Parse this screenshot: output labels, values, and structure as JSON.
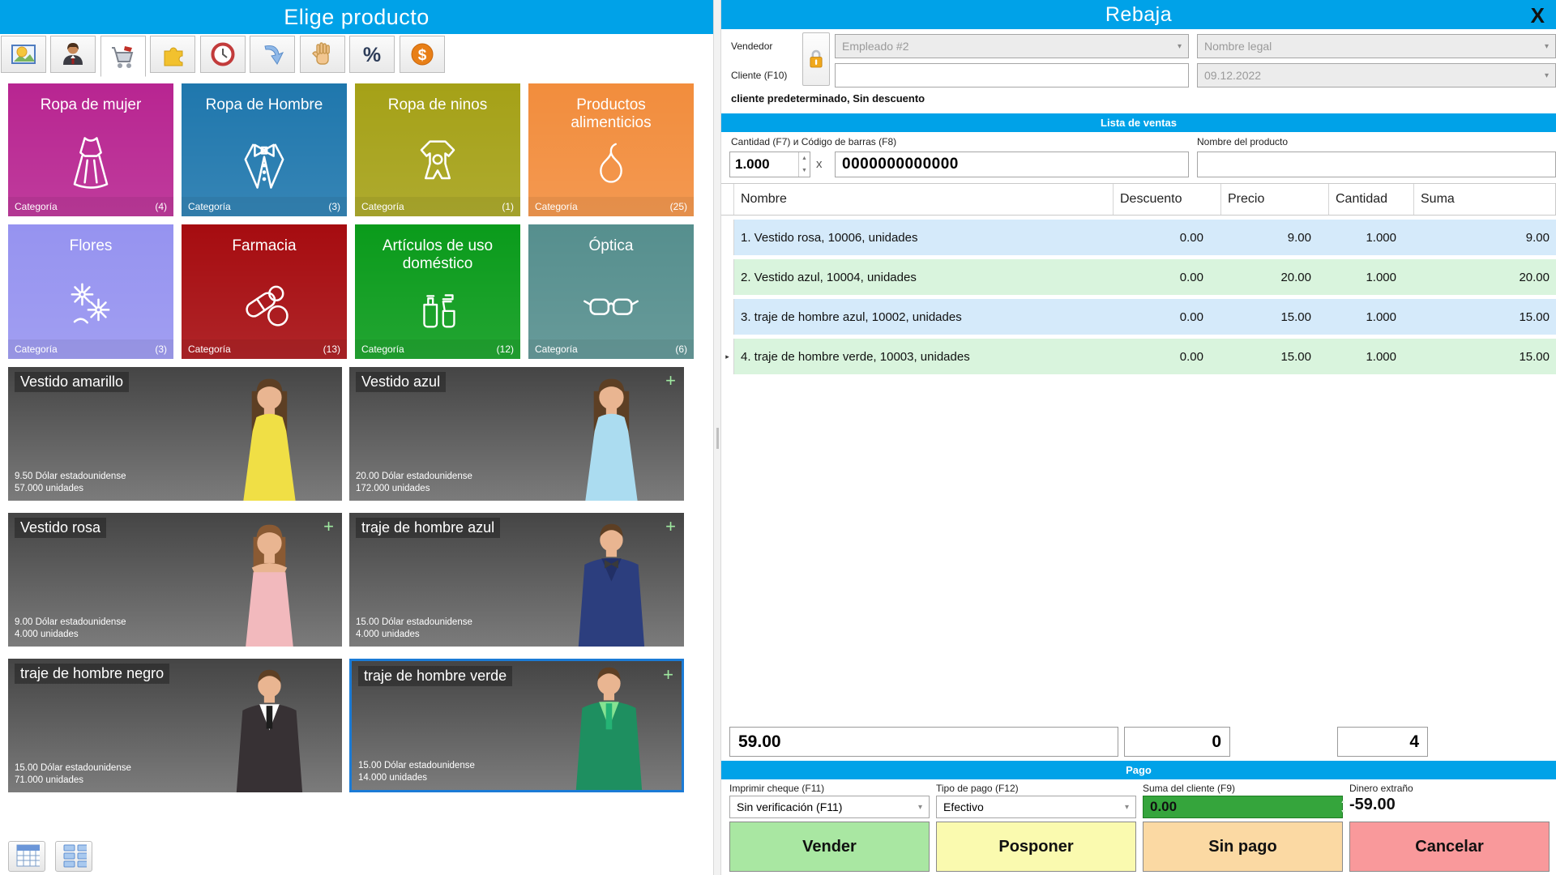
{
  "colors": {
    "titlebar_blue": "#00a2e8",
    "row_blue": "#d5eafa",
    "row_green": "#d9f4dd",
    "suma_input_green": "#35a53c"
  },
  "left_panel": {
    "title": "Elige producto",
    "toolbar": {
      "active_index": 2,
      "icons": [
        "picture-icon",
        "person-icon",
        "cart-icon",
        "puzzle-icon",
        "clock-icon",
        "arrow-icon",
        "hand-icon",
        "percent-icon",
        "dollar-icon"
      ]
    },
    "categories": [
      {
        "label": "Ropa de mujer",
        "footer": "Categoría",
        "count": "(4)",
        "color": "#b82591",
        "icon": "dress-icon"
      },
      {
        "label": "Ropa de Hombre",
        "footer": "Categoría",
        "count": "(3)",
        "color": "#1f77ad",
        "icon": "suit-icon"
      },
      {
        "label": "Ropa de ninos",
        "footer": "Categoría",
        "count": "(1)",
        "color": "#a5a117",
        "icon": "baby-clothes-icon"
      },
      {
        "label": "Productos alimenticios",
        "footer": "Categoría",
        "count": "(25)",
        "color": "#f28d3d",
        "icon": "pear-icon"
      },
      {
        "label": "Flores",
        "footer": "Categoría",
        "count": "(3)",
        "color": "#9693f0",
        "icon": "flowers-icon"
      },
      {
        "label": "Farmacia",
        "footer": "Categoría",
        "count": "(13)",
        "color": "#a60c10",
        "icon": "pills-icon"
      },
      {
        "label": "Artículos de uso doméstico",
        "footer": "Categoría",
        "count": "(12)",
        "color": "#0a9b1b",
        "icon": "cleaning-icon"
      },
      {
        "label": "Óptica",
        "footer": "Categoría",
        "count": "(6)",
        "color": "#568f8e",
        "icon": "glasses-icon"
      }
    ],
    "products": [
      {
        "name": "Vestido amarillo",
        "price": "9.50 Dólar estadounidense",
        "stock": "57.000 unidades",
        "plus": "",
        "selected": false
      },
      {
        "name": "Vestido azul",
        "price": "20.00 Dólar estadounidense",
        "stock": "172.000 unidades",
        "plus": "+",
        "selected": false
      },
      {
        "name": "Vestido rosa",
        "price": "9.00 Dólar estadounidense",
        "stock": "4.000 unidades",
        "plus": "+",
        "selected": false
      },
      {
        "name": "traje de hombre azul",
        "price": "15.00 Dólar estadounidense",
        "stock": "4.000 unidades",
        "plus": "+",
        "selected": false
      },
      {
        "name": "traje de hombre negro",
        "price": "15.00 Dólar estadounidense",
        "stock": "71.000 unidades",
        "plus": "",
        "selected": false
      },
      {
        "name": "traje de hombre verde",
        "price": "15.00 Dólar estadounidense",
        "stock": "14.000 unidades",
        "plus": "+",
        "selected": true
      }
    ],
    "view_buttons": [
      "table-view-icon",
      "tiles-view-icon"
    ]
  },
  "right_panel": {
    "title": "Rebaja",
    "close_label": "X",
    "form": {
      "vendedor_label": "Vendedor",
      "vendedor_value": "Empleado #2",
      "nombre_legal_value": "Nombre legal",
      "cliente_label": "Cliente (F10)",
      "cliente_value": "",
      "date_value": "09.12.2022",
      "status_line": "cliente predeterminado, Sin descuento"
    },
    "sales": {
      "header": "Lista de ventas",
      "qty_barcode_label": "Cantidad (F7) и Código de barras (F8)",
      "qty_value": "1.000",
      "times_label": "x",
      "barcode_value": "0000000000000",
      "product_name_label": "Nombre del producto",
      "product_name_value": "",
      "columns": [
        "Nombre",
        "Descuento",
        "Precio",
        "Cantidad",
        "Suma"
      ],
      "rows": [
        {
          "marker": "",
          "nombre": "1. Vestido rosa, 10006, unidades",
          "descuento": "0.00",
          "precio": "9.00",
          "cantidad": "1.000",
          "suma": "9.00",
          "bg": "#d5eafa"
        },
        {
          "marker": "",
          "nombre": "2. Vestido azul, 10004, unidades",
          "descuento": "0.00",
          "precio": "20.00",
          "cantidad": "1.000",
          "suma": "20.00",
          "bg": "#d9f4dd"
        },
        {
          "marker": "",
          "nombre": "3. traje de hombre azul, 10002, unidades",
          "descuento": "0.00",
          "precio": "15.00",
          "cantidad": "1.000",
          "suma": "15.00",
          "bg": "#d5eafa"
        },
        {
          "marker": "▸",
          "nombre": "4. traje de hombre verde, 10003, unidades",
          "descuento": "0.00",
          "precio": "15.00",
          "cantidad": "1.000",
          "suma": "15.00",
          "bg": "#d9f4dd"
        }
      ],
      "totals": {
        "suma": "59.00",
        "descuento": "0",
        "cantidad": "4"
      }
    },
    "payment": {
      "header": "Pago",
      "imprimir_label": "Imprimir cheque (F11)",
      "imprimir_value": "Sin verificación (F11)",
      "tipo_label": "Tipo de pago (F12)",
      "tipo_value": "Efectivo",
      "suma_label": "Suma del cliente (F9)",
      "suma_value": "0.00",
      "dinero_label": "Dinero extraño",
      "dinero_value": "-59.00",
      "buttons": [
        {
          "label": "Vender",
          "bg": "#a9e7a2"
        },
        {
          "label": "Posponer",
          "bg": "#fafaaf"
        },
        {
          "label": "Sin pago",
          "bg": "#fbd9a3"
        },
        {
          "label": "Cancelar",
          "bg": "#f9999b"
        }
      ]
    }
  }
}
